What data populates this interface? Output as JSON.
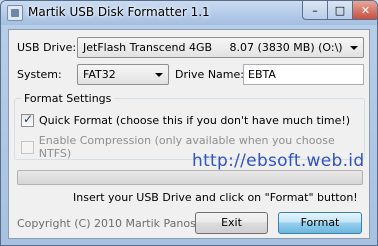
{
  "window": {
    "title": "Martik USB Disk Formatter 1.1"
  },
  "titlebar_buttons": {
    "minimize": "–",
    "maximize": "□",
    "close": "✕"
  },
  "usb_drive": {
    "label": "USB Drive:",
    "value": "JetFlash Transcend 4GB     8.07 (3830 MB) (O:\\)"
  },
  "system": {
    "label": "System:",
    "value": "FAT32"
  },
  "drive_name": {
    "label": "Drive Name:",
    "value": "EBTA"
  },
  "format_settings": {
    "title": "Format Settings",
    "quick_format": {
      "label": "Quick Format (choose this if you don't have much time!)",
      "checked": true
    },
    "compression": {
      "label": "Enable Compression (only available when you choose NTFS)",
      "checked": false,
      "enabled": false
    }
  },
  "watermark": "http://ebsoft.web.id",
  "progress": {
    "value": 0
  },
  "status_text": "Insert your USB Drive and click on \"Format\" button!",
  "copyright": "Copyright (C) 2010 Martik Panosian",
  "buttons": {
    "exit": "Exit",
    "format": "Format"
  }
}
